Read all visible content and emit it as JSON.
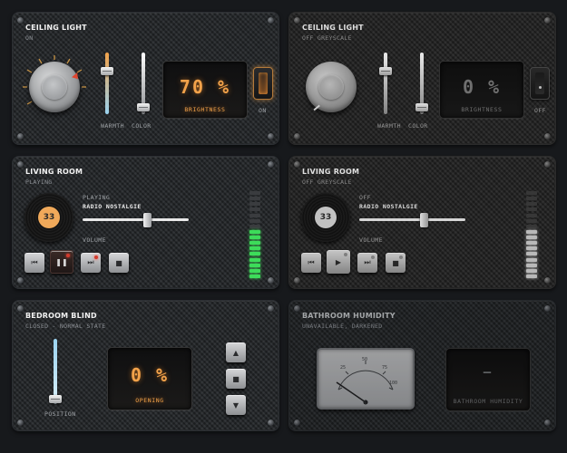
{
  "ceiling_light_on": {
    "title": "CEILING LIGHT",
    "subtitle": "ON",
    "warmth_label": "WARMTH",
    "color_label": "COLOR",
    "brightness_value": "70 %",
    "brightness_caption": "BRIGHTNESS",
    "toggle_label": "ON",
    "warmth_level": 0.85,
    "color_level": 0.15
  },
  "ceiling_light_off": {
    "title": "CEILING LIGHT",
    "subtitle": "OFF GREYSCALE",
    "warmth_label": "WARMTH",
    "color_label": "COLOR",
    "brightness_value": "0 %",
    "brightness_caption": "BRIGHTNESS",
    "toggle_label": "OFF",
    "warmth_level": 0.85,
    "color_level": 0.15
  },
  "living_room_playing": {
    "title": "LIVING ROOM",
    "subtitle": "PLAYING",
    "status": "PLAYING",
    "station": "RADIO NOSTALGIE",
    "volume_label": "VOLUME",
    "volume_level": 0.6,
    "record_label": "33",
    "meter_level": 0.55
  },
  "living_room_off": {
    "title": "LIVING ROOM",
    "subtitle": "OFF GREYSCALE",
    "status": "OFF",
    "station": "RADIO NOSTALGIE",
    "volume_label": "VOLUME",
    "volume_level": 0.6,
    "record_label": "33",
    "meter_level": 0.55
  },
  "bedroom_blind": {
    "title": "BEDROOM BLIND",
    "subtitle": "CLOSED - NORMAL STATE",
    "position_label": "POSITION",
    "position_level": 0.0,
    "value": "0 %",
    "caption": "OPENING"
  },
  "bathroom_humidity": {
    "title": "BATHROOM HUMIDITY",
    "subtitle": "UNAVAILABLE, DARKENED",
    "gauge_ticks": [
      "25",
      "50",
      "75",
      "100"
    ],
    "gauge_unit": "%",
    "value": "—",
    "caption": "BATHROOM HUMIDITY"
  },
  "colors": {
    "accent_orange": "#f2a24a",
    "led_red": "#d33a2c",
    "meter_green": "#3ddc5a",
    "warmth_blue": "#9ad3f0"
  }
}
